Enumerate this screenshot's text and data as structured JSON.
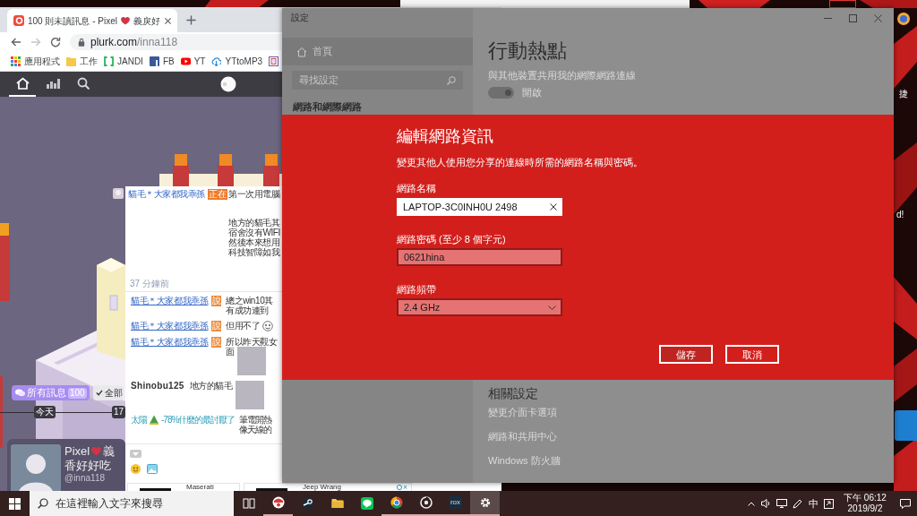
{
  "browser": {
    "tab": {
      "title": "100 則未讀訊息 - Pixel",
      "title_after_heart": "義戾好"
    },
    "address": {
      "domain": "plurk.com",
      "path": "/inna118"
    },
    "bookmarks": [
      {
        "kind": "apps",
        "label": "應用程式"
      },
      {
        "kind": "folder",
        "label": "工作"
      },
      {
        "kind": "jandi",
        "label": "JANDI"
      },
      {
        "kind": "facebook",
        "label": "FB"
      },
      {
        "kind": "youtube",
        "label": "YT"
      },
      {
        "kind": "cloud",
        "label": "YTtoMP3"
      },
      {
        "kind": "document"
      }
    ]
  },
  "plurk": {
    "nav": [
      {
        "kind": "home",
        "selected": true
      },
      {
        "kind": "stats",
        "selected": false
      },
      {
        "kind": "search",
        "selected": false
      }
    ],
    "post": {
      "author": "貓毛＊大家都我乖孫",
      "verb": "正在",
      "paragraphs": [
        [
          "第一次用電腦"
        ],
        [
          "地方的貓毛其",
          "宿舍沒有WIFI",
          "然後本來想用",
          "科技智障如我"
        ]
      ],
      "time": "37 分鐘前"
    },
    "responses": [
      {
        "kind": "qualified",
        "author": "貓毛＊大家都我乖孫",
        "verb": "說",
        "lines": [
          "總之win10其",
          "有成功連到"
        ]
      },
      {
        "kind": "qualified",
        "author": "貓毛＊大家都我乖孫",
        "verb": "說",
        "lines": [
          "但用不了"
        ],
        "attachment": {
          "kind": "emoji"
        }
      },
      {
        "kind": "qualified",
        "author": "貓毛＊大家都我乖孫",
        "verb": "說",
        "lines": [
          "所以昨天觀女",
          "面"
        ],
        "attachment": {
          "kind": "photo"
        }
      },
      {
        "kind": "plain",
        "author": "Shinobu125",
        "lines": [
          "地方的貓毛"
        ],
        "attachment": {
          "kind": "photo"
        }
      },
      {
        "kind": "status",
        "author": "太陽",
        "status": "-78%什麼的最討厭了",
        "lines": [
          "筆電開熱",
          "像天線的"
        ]
      }
    ],
    "ads": [
      {
        "title": "Maserati"
      },
      {
        "title": "Jeep Wrang"
      }
    ],
    "message_filter": {
      "label": "所有訊息",
      "count": "100"
    },
    "mark_button": {
      "label": "全部"
    },
    "timeline": [
      "今天",
      "17"
    ],
    "profile": {
      "name": "Pixel",
      "name_after_heart": "義",
      "nickname": "香好好吃",
      "handle": "@inna118"
    }
  },
  "settings": {
    "title": "設定",
    "sidebar": {
      "home": "首頁",
      "search_placeholder": "尋找設定",
      "section": "網路和網際網路"
    },
    "page": {
      "title": "行動熱點",
      "description": "與其他裝置共用我的網際網路連線",
      "toggle": {
        "on": true,
        "label": "開啟"
      }
    },
    "dialog": {
      "title": "編輯網路資訊",
      "description": "變更其他人使用您分享的連線時所需的網路名稱與密碼。",
      "fields": [
        {
          "kind": "text",
          "label": "網路名稱",
          "value": "LAPTOP-3C0INH0U 2498",
          "focused": true
        },
        {
          "kind": "text",
          "label": "網路密碼 (至少 8 個字元)",
          "value": "0621hina",
          "focused": false
        },
        {
          "kind": "select",
          "label": "網路頻帶",
          "value": "2.4 GHz",
          "focused": false
        }
      ],
      "buttons": [
        {
          "label": "儲存",
          "primary": true
        },
        {
          "label": "取消",
          "primary": false
        }
      ]
    },
    "related": {
      "title": "相關設定",
      "links": [
        "變更介面卡選項",
        "網路和共用中心",
        "Windows 防火牆"
      ]
    }
  },
  "desktop_fragments": [
    "捷",
    "d!"
  ],
  "taskbar": {
    "search_placeholder": "在這裡輸入文字來搜尋",
    "apps": [
      {
        "kind": "task-view",
        "running": false,
        "active": false
      },
      {
        "kind": "badge",
        "running": true,
        "active": false
      },
      {
        "kind": "steam",
        "running": false,
        "active": false
      },
      {
        "kind": "folder",
        "running": false,
        "active": false
      },
      {
        "kind": "line",
        "running": false,
        "active": false
      },
      {
        "kind": "chrome",
        "running": true,
        "active": false
      },
      {
        "kind": "disc",
        "running": true,
        "active": false
      },
      {
        "kind": "rox",
        "logo_text": "rox",
        "running": true,
        "active": false
      },
      {
        "kind": "settings",
        "running": true,
        "active": true
      }
    ],
    "ime": "中",
    "time": "下午 06:12",
    "date": "2019/9/2"
  }
}
